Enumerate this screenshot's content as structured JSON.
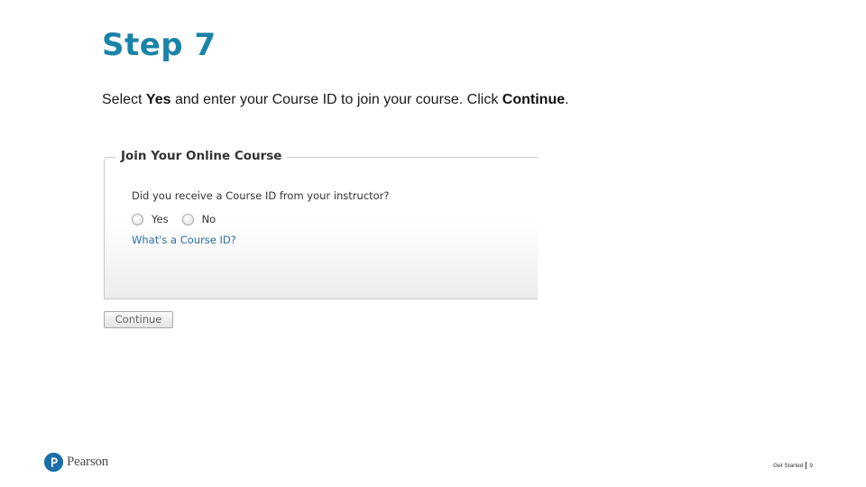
{
  "slide": {
    "title": "Step 7",
    "instruction": {
      "part1": "Select ",
      "yes": "Yes",
      "part2": " and enter your Course ID to join your course. Click ",
      "continue": "Continue",
      "part3": "."
    }
  },
  "panel": {
    "legend": "Join Your Online Course",
    "question": "Did you receive a Course ID from your instructor?",
    "options": [
      {
        "label": "Yes",
        "selected": false
      },
      {
        "label": "No",
        "selected": false
      }
    ],
    "help_link": "What's a Course ID?"
  },
  "continue_button": {
    "label": "Continue"
  },
  "footer": {
    "brand": "Pearson",
    "section": "Get Started",
    "page": "9",
    "brand_color": "#1b6fa8"
  },
  "colors": {
    "title": "#1b83a8",
    "link": "#2a6fa8"
  }
}
